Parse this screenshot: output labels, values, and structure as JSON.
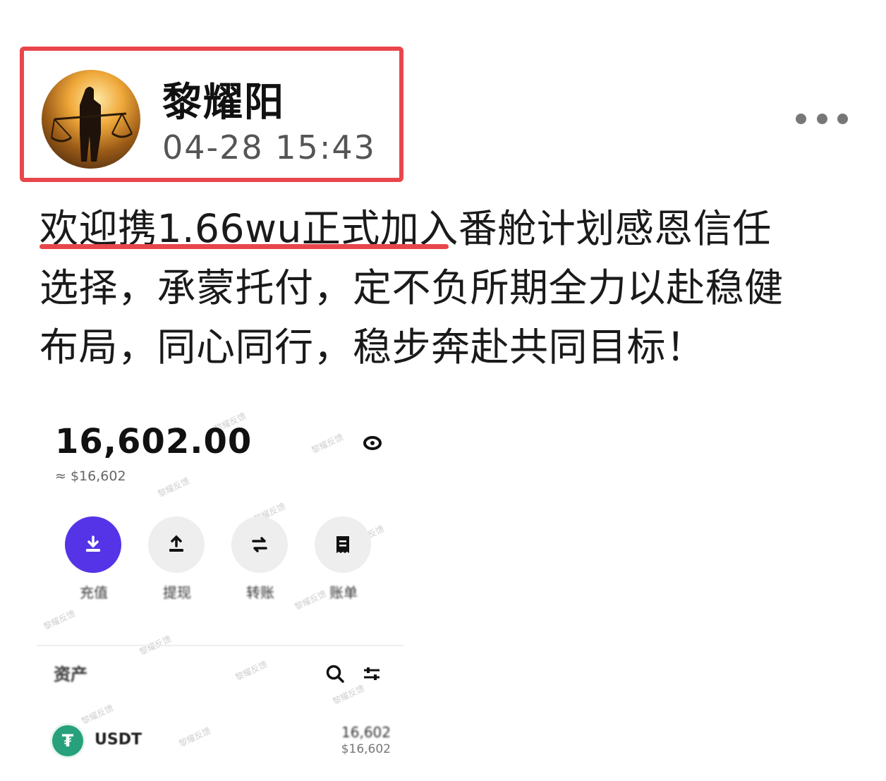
{
  "post": {
    "author": "黎耀阳",
    "time": "04-28 15:43",
    "text": "欢迎携1.66wu正式加入番舱计划感恩信任选择，承蒙托付，定不负所期全力以赴稳健布局，同心同行，稳步奔赴共同目标！"
  },
  "wallet": {
    "balance": "16,602.00",
    "approx_usd": "≈ $16,602",
    "actions": [
      {
        "label": "充值",
        "icon": "deposit-icon"
      },
      {
        "label": "提现",
        "icon": "withdraw-icon"
      },
      {
        "label": "转账",
        "icon": "transfer-icon"
      },
      {
        "label": "账单",
        "icon": "bill-icon"
      }
    ],
    "assets_title": "资产",
    "asset": {
      "name": "USDT",
      "amount": "16,602",
      "usd": "$16,602"
    },
    "watermark": "黎耀反馈"
  },
  "colors": {
    "highlight_red": "#e8464b",
    "primary_purple": "#5534e8",
    "usdt_green": "#26a17b"
  }
}
